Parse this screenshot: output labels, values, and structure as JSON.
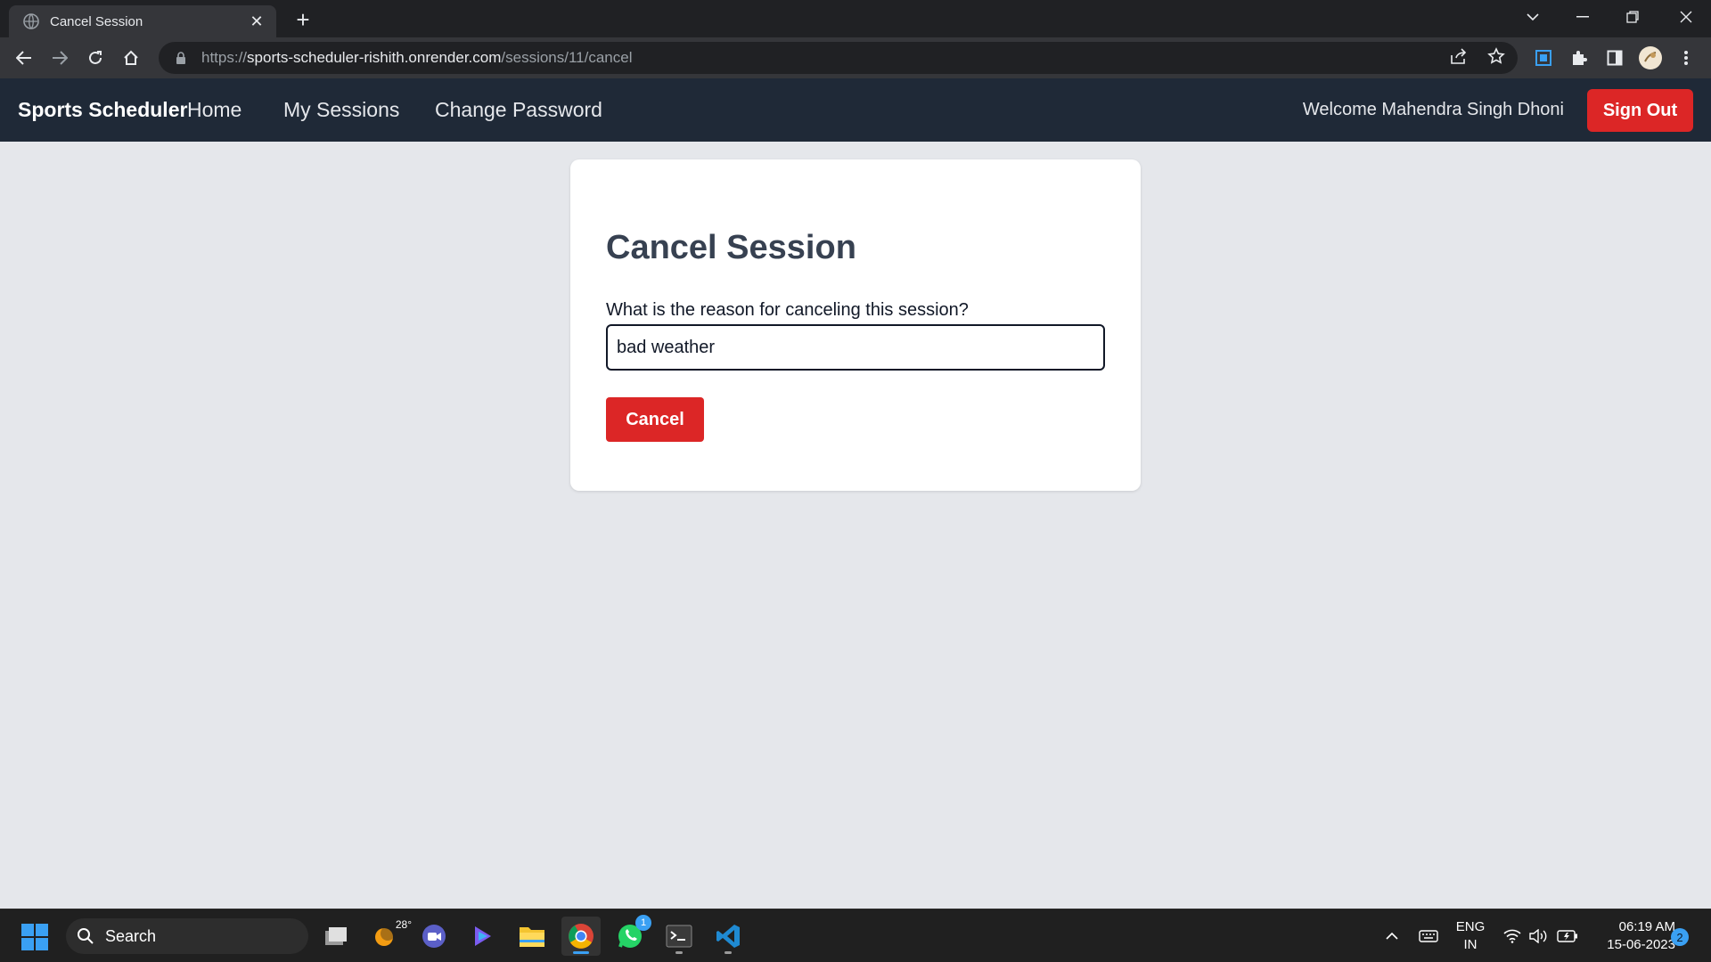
{
  "browser": {
    "tab_title": "Cancel Session",
    "url_scheme": "https://",
    "url_host": "sports-scheduler-rishith.onrender.com",
    "url_path": "/sessions/11/cancel"
  },
  "nav": {
    "brand": "Sports Scheduler",
    "links": [
      "Home",
      "My Sessions",
      "Change Password"
    ],
    "welcome": "Welcome Mahendra Singh Dhoni",
    "signout": "Sign Out"
  },
  "card": {
    "title": "Cancel Session",
    "label": "What is the reason for canceling this session?",
    "reason_value": "bad weather",
    "button": "Cancel"
  },
  "taskbar": {
    "search": "Search",
    "weather_temp": "28°",
    "whatsapp_badge": "1",
    "lang_line1": "ENG",
    "lang_line2": "IN",
    "time": "06:19 AM",
    "date": "15-06-2023",
    "notifications": "2"
  },
  "colors": {
    "accent_red": "#dc2626",
    "nav_bg": "#1f2937",
    "page_bg": "#e5e7eb"
  }
}
